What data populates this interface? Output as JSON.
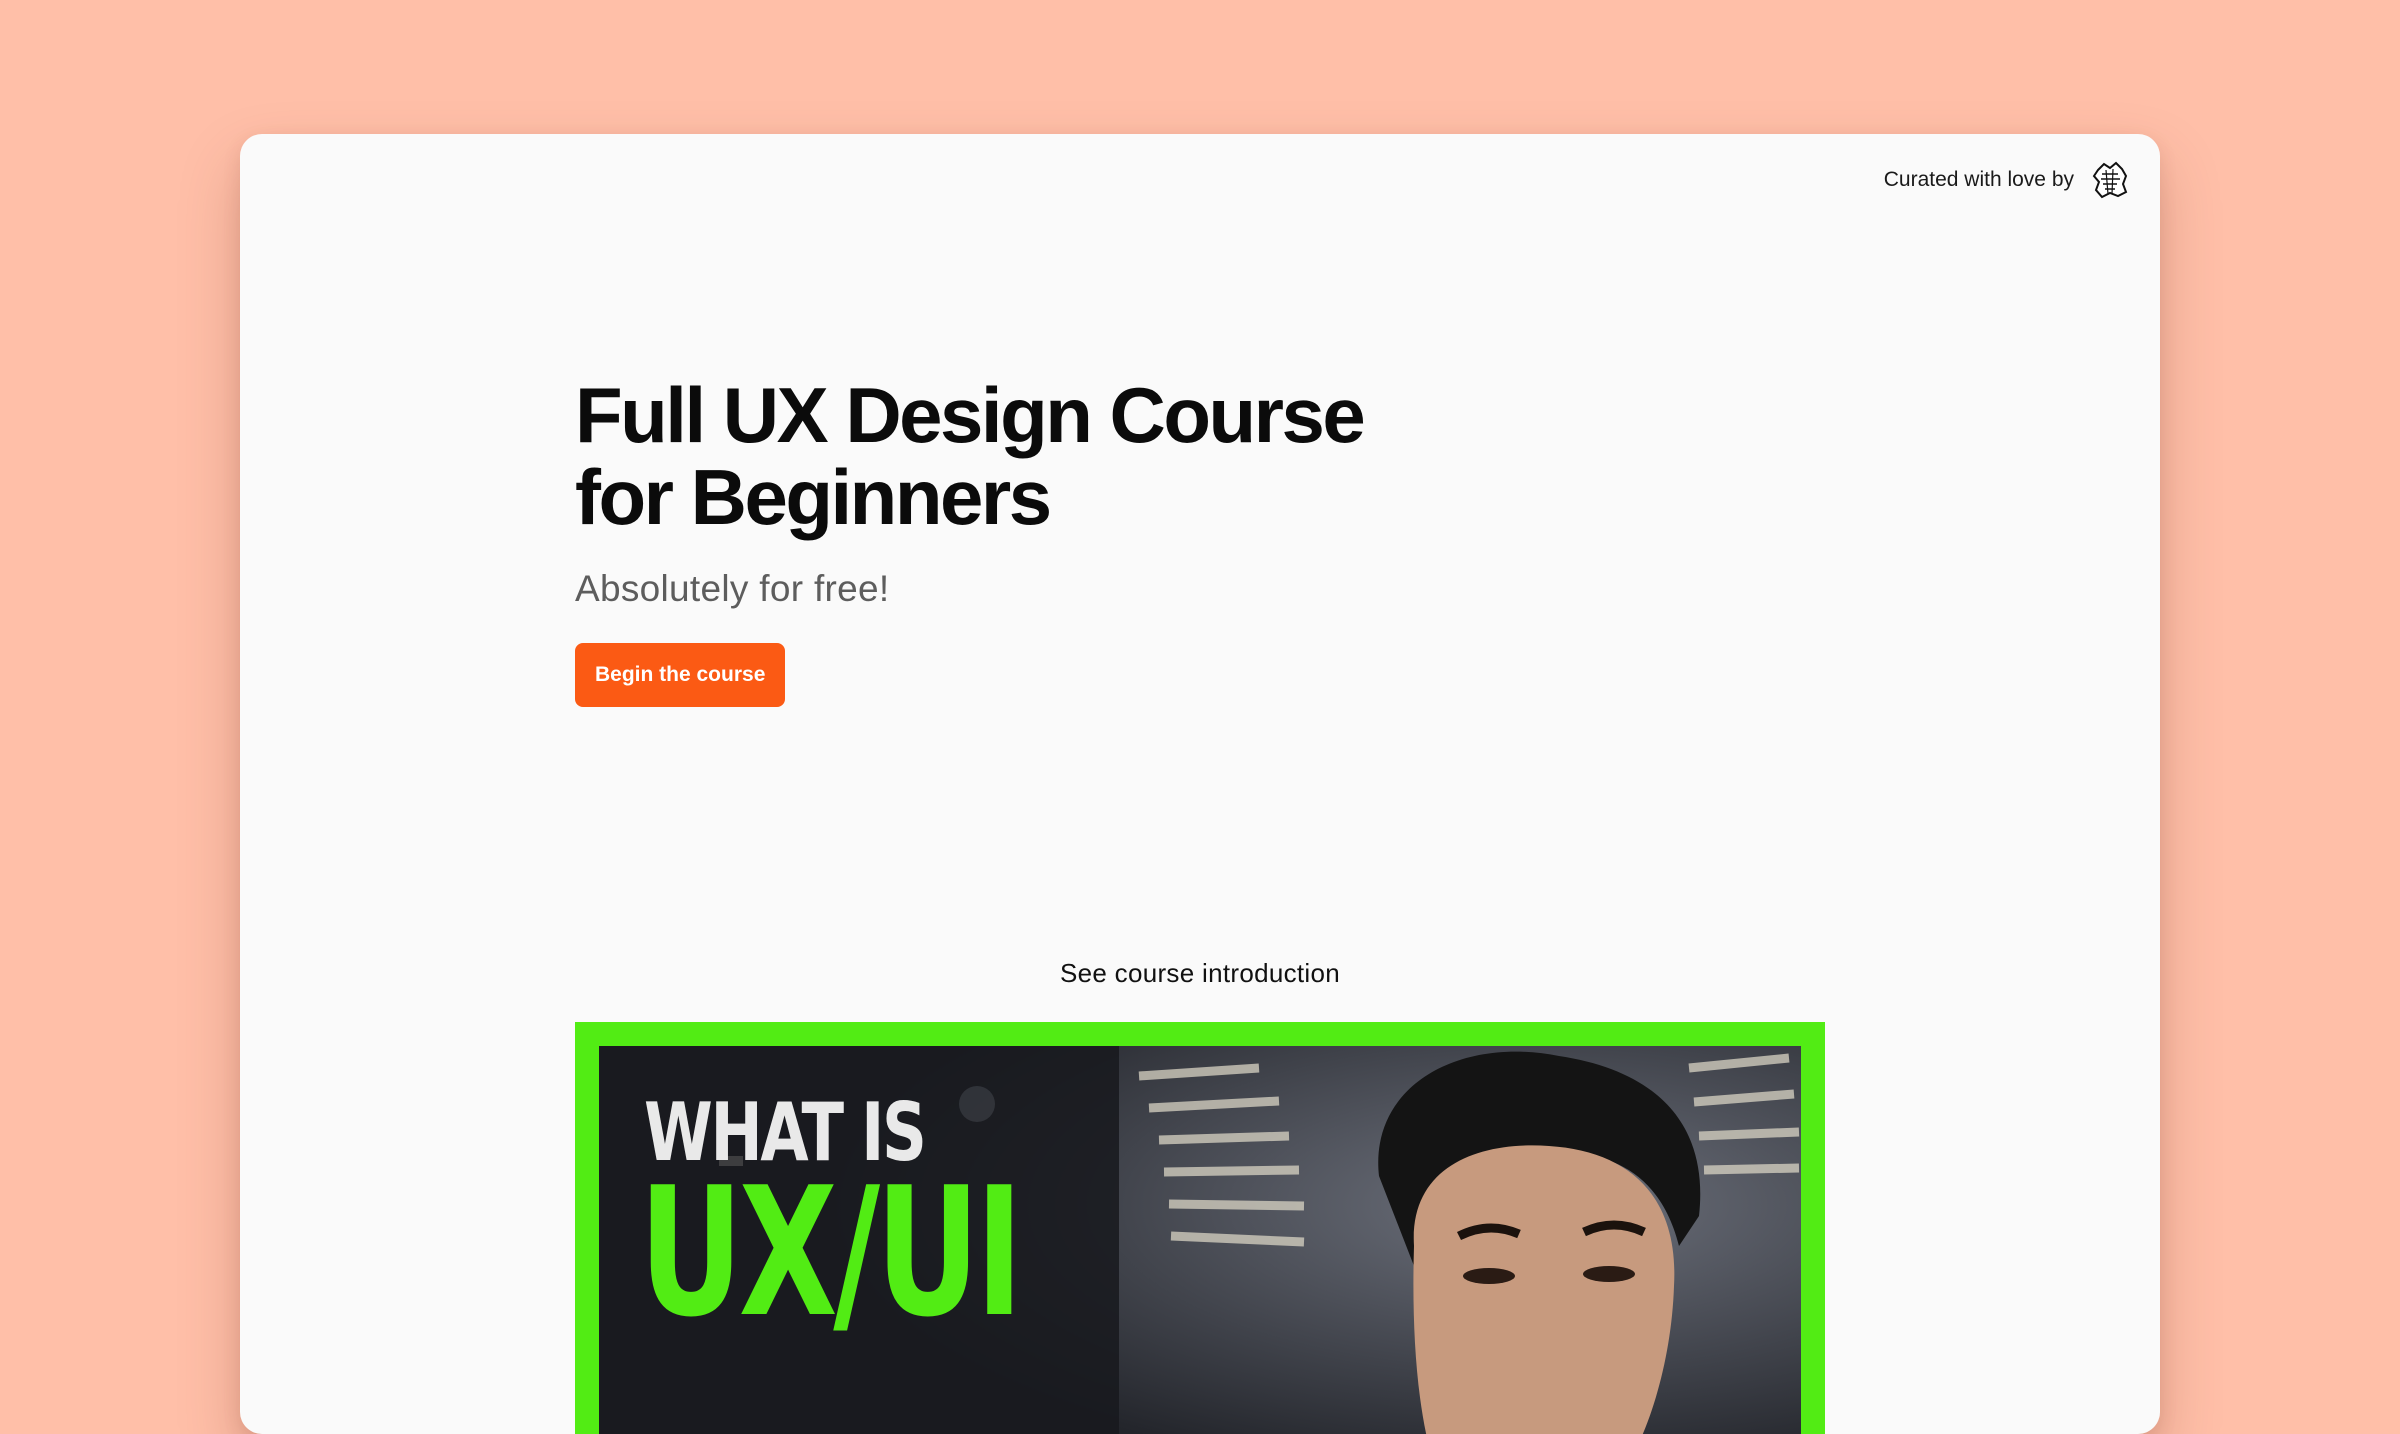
{
  "header": {
    "curated_label": "Curated with love by",
    "curator_logo_icon": "sketch-badge-icon"
  },
  "hero": {
    "title": "Full UX Design Course\nfor Beginners",
    "subtitle": "Absolutely for free!",
    "cta_label": "Begin the course"
  },
  "intro": {
    "label": "See course introduction",
    "thumbnail": {
      "line1": "WHAT IS",
      "line2": "UX/UI",
      "accent_color": "#52ec14"
    }
  },
  "colors": {
    "background": "#ffbfa8",
    "card": "#fafafa",
    "cta": "#fb5a14",
    "thumbnail_border": "#52ec14"
  }
}
